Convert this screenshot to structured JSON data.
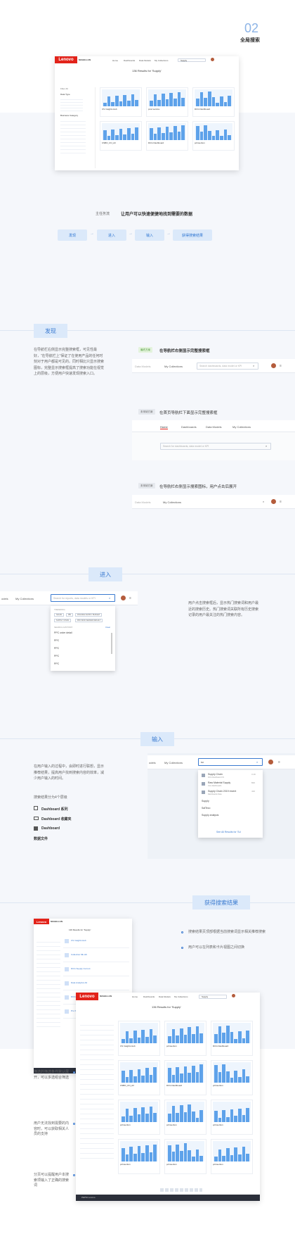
{
  "section_number": "02",
  "section_title": "全局搜索",
  "hero": {
    "brand": "Lenovo",
    "product": "MAGELLAN",
    "nav": [
      "Home",
      "Dashboards",
      "Data Models",
      "My Collections"
    ],
    "search_value": "Supply",
    "results_title": "136 Results for 'Supply'",
    "filter_label": "Filter All",
    "group_filter": "Data Type",
    "group_filter_2": "Business Category",
    "tiles": [
      "CS Insights Hub",
      "prod service",
      "DCG Dashboard",
      "CSBO_CN_All",
      "DCG Dashboard",
      "pcInsertion"
    ]
  },
  "theme": {
    "label": "主任务流",
    "text": "让用户可以快速便捷地找到需要的数据"
  },
  "flow": [
    "发现",
    "进入",
    "输入",
    "获得搜索结果"
  ],
  "discover": {
    "title": "发现",
    "desc": "在导航栏右侧显示完整搜索框，可见性最好，“在导航栏上”保证了在使用产品的任何时刻对于用户都是可见的。同时相比只显示搜索图标，完整显示搜索框提高了搜索功能在视觉上的层级，方便用户快速发现搜索入口。",
    "cases": [
      {
        "tag": "最终方案",
        "title": "在导航栏右侧显示完整搜索框",
        "nav1": "Data Models",
        "nav2": "My Collections",
        "placeholder": "Search dashboards, data model or KPI"
      },
      {
        "tag": "未采纳方案",
        "title": "在首页导航栏下面显示完整搜索框",
        "nav": [
          "Home",
          "Dashboards",
          "Data Models",
          "My Collections"
        ],
        "placeholder": "Search for dashboards, data model or KPI"
      },
      {
        "tag": "未采纳方案",
        "title": "在导航栏右侧显示搜索图标，用户点击后展开",
        "nav1": "Data Models",
        "nav2": "My Collections"
      }
    ]
  },
  "enter": {
    "title": "进入",
    "desc": "用户点击搜索框后，显示热门搜索词和用户最近的搜索历史。热门搜索词关联所有历史搜索记录的用户最关注的热门搜索内容。",
    "nav_prev": "odels",
    "nav": "My Collections",
    "placeholder": "Search for reports, data models or KPI",
    "trending_label": "TRENDING",
    "trending": [
      "SALES",
      "PBI",
      "FINANCE SUPPLY BUDGET",
      "SUPPLY CHAIN",
      "PRO MOD SERVER RESULT"
    ],
    "history_label": "SEARCH HISTORY",
    "clear": "Clear",
    "history": [
      "PPC order detail",
      "PPC",
      "PPC",
      "PPC",
      "PPC"
    ]
  },
  "input": {
    "title": "输入",
    "desc": "在用户输入的过程中，会即时进行联想，显示推荐结果，提高用户找到搜索内容的效率，减少用户输入的时间。",
    "types_label": "搜索结果分为4个层级",
    "types": [
      "Dashboard 系列",
      "Dashboard 收藏夹",
      "Dashboard",
      "数据文件"
    ],
    "nav_prev": "odels",
    "nav": "My Collections",
    "query": "su",
    "suggestions": [
      {
        "name": "Supply Chain",
        "sub": "DCG Dashboard CN",
        "count": "3.1K"
      },
      {
        "name": "Raw Material Supply",
        "sub": "Cost Dashboards",
        "count": "820"
      },
      {
        "name": "Supply Chain 2019 recent",
        "sub": "Dashboards Data",
        "count": "410"
      },
      {
        "name": "Supply",
        "sub": "",
        "count": ""
      },
      {
        "name": "SalTeco",
        "sub": "",
        "count": ""
      },
      {
        "name": "Supply analysis",
        "sub": "",
        "count": ""
      }
    ],
    "see_all": "See All Results for 'Su'"
  },
  "results": {
    "title": "获得搜索结果",
    "notes": [
      "搜索结果页顶部根据当前搜索词显示相关推荐搜索",
      "用户可以在列表和卡片视图之间切换",
      "筛选的筛选条件默认展开，可以多选组合筛选",
      "用户无法找到需要的内容时，可以获取相关人员的支持",
      "分页可以提醒用户本搜索项输入了正确的搜索词"
    ],
    "page_title": "136 Results for 'Supply'",
    "list_items": [
      "CS Insights Hub",
      "Collection Mk HK",
      "DCG Supply Current",
      "Data Analytics All",
      "DCG Dashboard",
      "Pro SAM SUPPLY"
    ],
    "card_tiles": [
      "CS Insights Hub",
      "pcInsertion",
      "DCG Dashboard",
      "CSBO_CN_All",
      "DCG Dashboard",
      "pcInsertion",
      "pcInsertion",
      "pcInsertion",
      "pcInsertion",
      "pcInsertion",
      "pcInsertion",
      "pcInsertion"
    ],
    "footer_brand": "PEPSI Lenovo"
  }
}
